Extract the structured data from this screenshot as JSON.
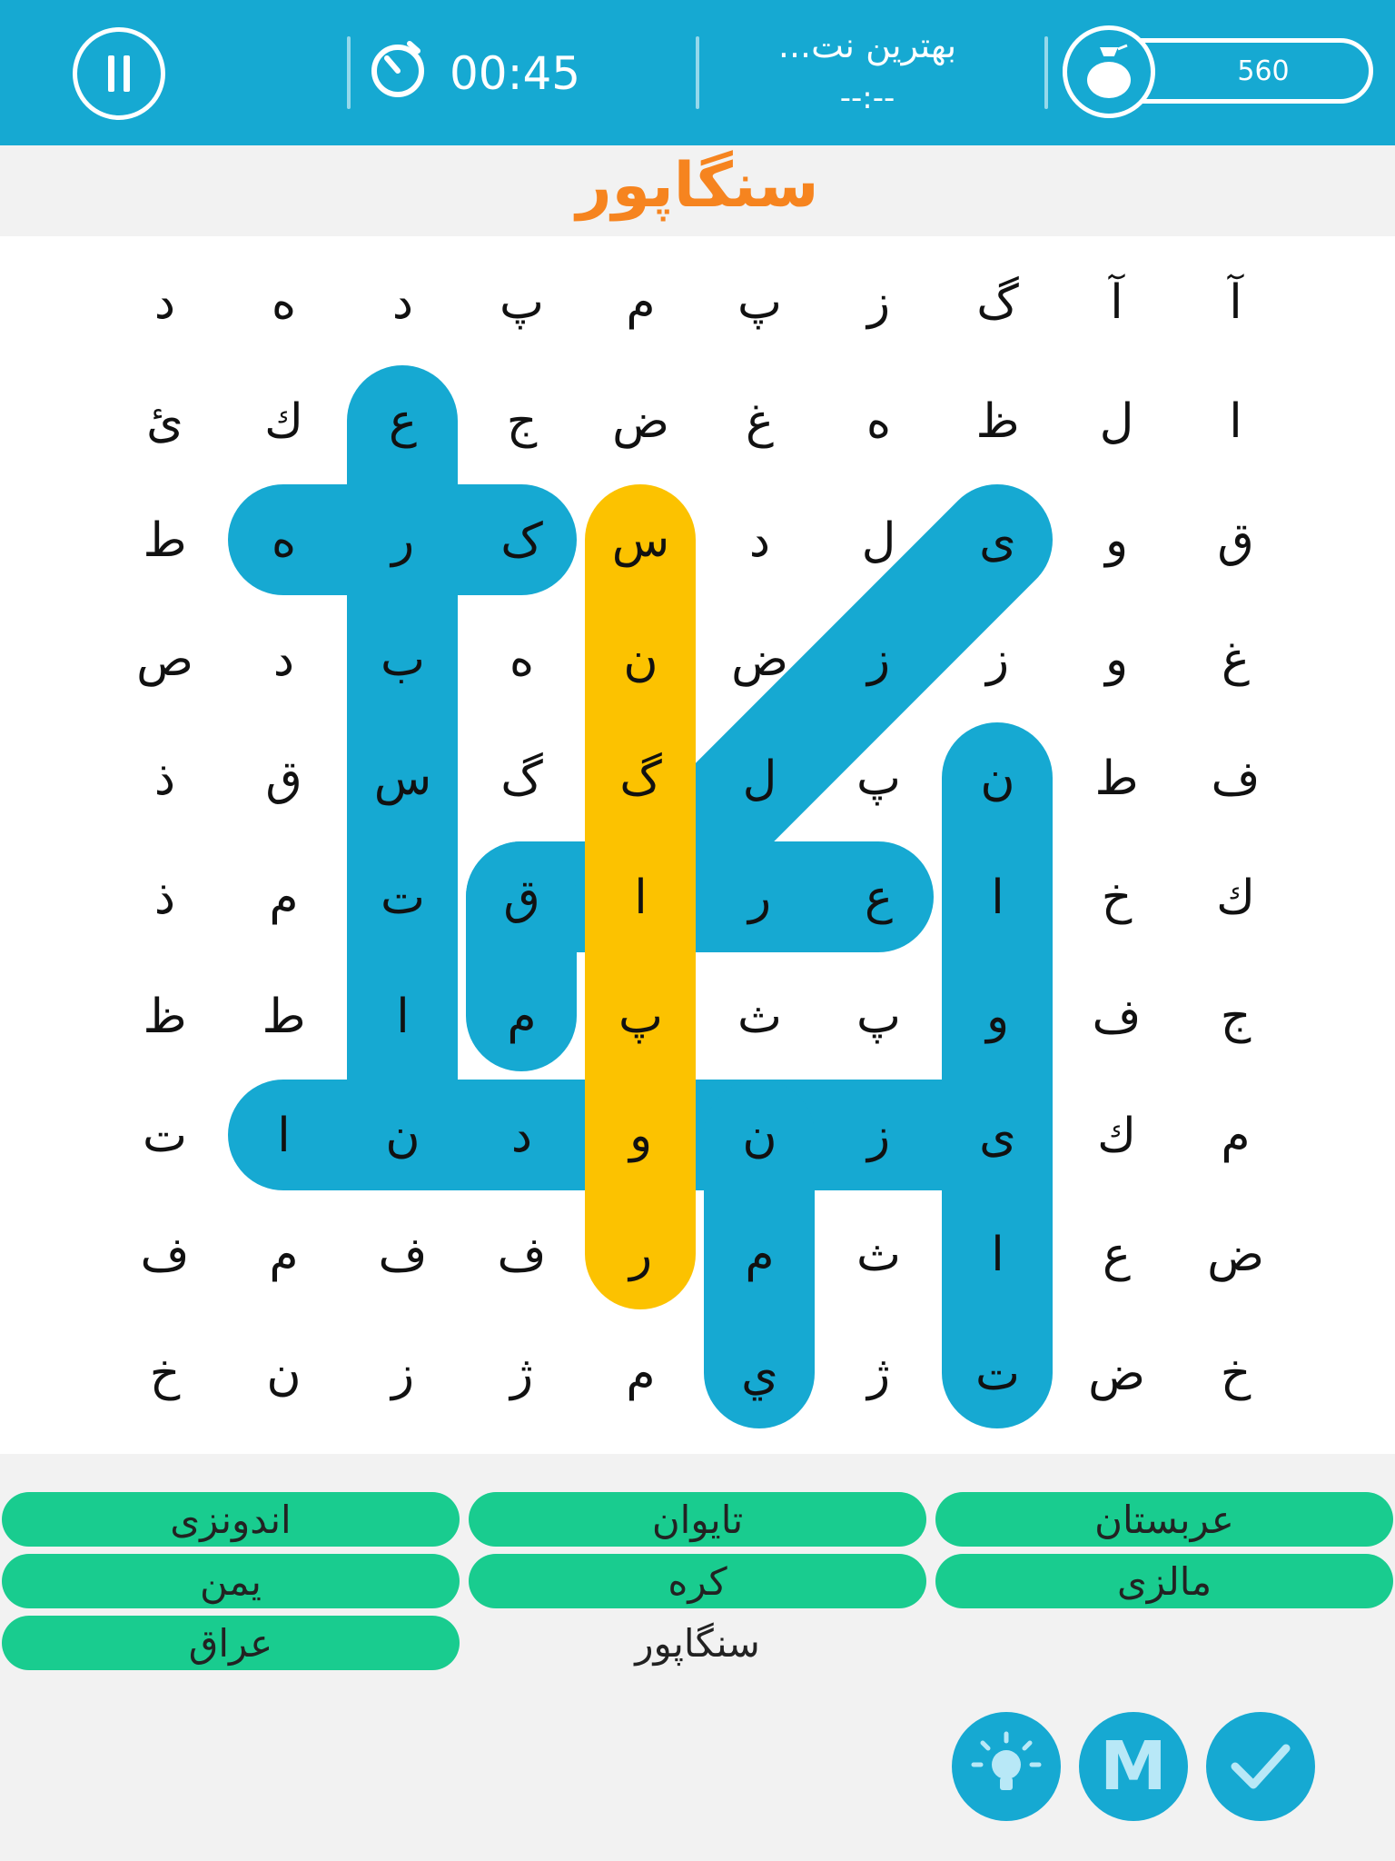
{
  "header": {
    "timer": "00:45",
    "best_title": "بهترین نت...",
    "best_value": "--:--",
    "coins": "560",
    "pause_icon": "pause-icon",
    "timer_icon": "stopwatch-icon",
    "coin_icon": "money-bag-icon"
  },
  "current_word": "سنگاپور",
  "grid": [
    [
      "آ",
      "آ",
      "گ",
      "ز",
      "پ",
      "م",
      "پ",
      "د",
      "ه",
      "د"
    ],
    [
      "ا",
      "ل",
      "ظ",
      "ه",
      "غ",
      "ض",
      "ج",
      "ع",
      "ك",
      "ئ"
    ],
    [
      "ق",
      "و",
      "ی",
      "ل",
      "د",
      "س",
      "ک",
      "ر",
      "ه",
      "ط"
    ],
    [
      "غ",
      "و",
      "ز",
      "ز",
      "ض",
      "ن",
      "ه",
      "ب",
      "د",
      "ص"
    ],
    [
      "ف",
      "ط",
      "ن",
      "پ",
      "ل",
      "گ",
      "گ",
      "س",
      "ق",
      "ذ"
    ],
    [
      "ك",
      "خ",
      "ا",
      "ع",
      "ر",
      "ا",
      "ق",
      "ت",
      "م",
      "ذ"
    ],
    [
      "ج",
      "ف",
      "و",
      "پ",
      "ث",
      "پ",
      "م",
      "ا",
      "ط",
      "ظ"
    ],
    [
      "م",
      "ك",
      "ی",
      "ز",
      "ن",
      "و",
      "د",
      "ن",
      "ا",
      "ت"
    ],
    [
      "ض",
      "ع",
      "ا",
      "ث",
      "م",
      "ر",
      "ف",
      "ف",
      "م",
      "ف"
    ],
    [
      "خ",
      "ض",
      "ت",
      "ژ",
      "ي",
      "م",
      "ژ",
      "ز",
      "ن",
      "خ"
    ]
  ],
  "found_paths": [
    {
      "word": "عربستان",
      "color": "#16a9d2",
      "from": [
        1,
        7
      ],
      "to": [
        7,
        7
      ]
    },
    {
      "word": "کره",
      "color": "#16a9d2",
      "from": [
        2,
        6
      ],
      "to": [
        2,
        8
      ]
    },
    {
      "word": "اندونزی",
      "color": "#16a9d2",
      "from": [
        7,
        8
      ],
      "to": [
        7,
        2
      ]
    },
    {
      "word": "مالزی",
      "color": "#16a9d2",
      "from": [
        9,
        4
      ],
      "to": [
        7,
        4
      ]
    },
    {
      "word": "تایوان",
      "color": "#16a9d2",
      "from": [
        9,
        2
      ],
      "to": [
        4,
        2
      ]
    },
    {
      "word": "یمن_diag",
      "color": "#16a9d2",
      "from": [
        2,
        2
      ],
      "to": [
        5,
        5
      ]
    },
    {
      "word": "عراق",
      "color": "#16a9d2",
      "from": [
        5,
        3
      ],
      "to": [
        5,
        6
      ]
    },
    {
      "word": "قم",
      "color": "#16a9d2",
      "from": [
        5,
        6
      ],
      "to": [
        6,
        6
      ]
    },
    {
      "word": "سنگاپور",
      "color": "#fcc200",
      "from": [
        2,
        5
      ],
      "to": [
        8,
        5
      ]
    }
  ],
  "word_list": [
    {
      "label": "عربستان",
      "found": true
    },
    {
      "label": "تایوان",
      "found": true
    },
    {
      "label": "اندونزی",
      "found": true
    },
    {
      "label": "مالزی",
      "found": true
    },
    {
      "label": "کره",
      "found": true
    },
    {
      "label": "یمن",
      "found": true
    },
    {
      "label": "",
      "found": false
    },
    {
      "label": "سنگاپور",
      "found": false
    },
    {
      "label": "عراق",
      "found": true
    }
  ],
  "buttons": {
    "hint_icon": "lightbulb-icon",
    "m_label": "M",
    "check_icon": "checkmark-icon"
  },
  "colors": {
    "header": "#16a9d2",
    "highlight": "#16a9d2",
    "active_highlight": "#fcc200",
    "found_pill": "#19cc8f",
    "title": "#f6841f"
  }
}
